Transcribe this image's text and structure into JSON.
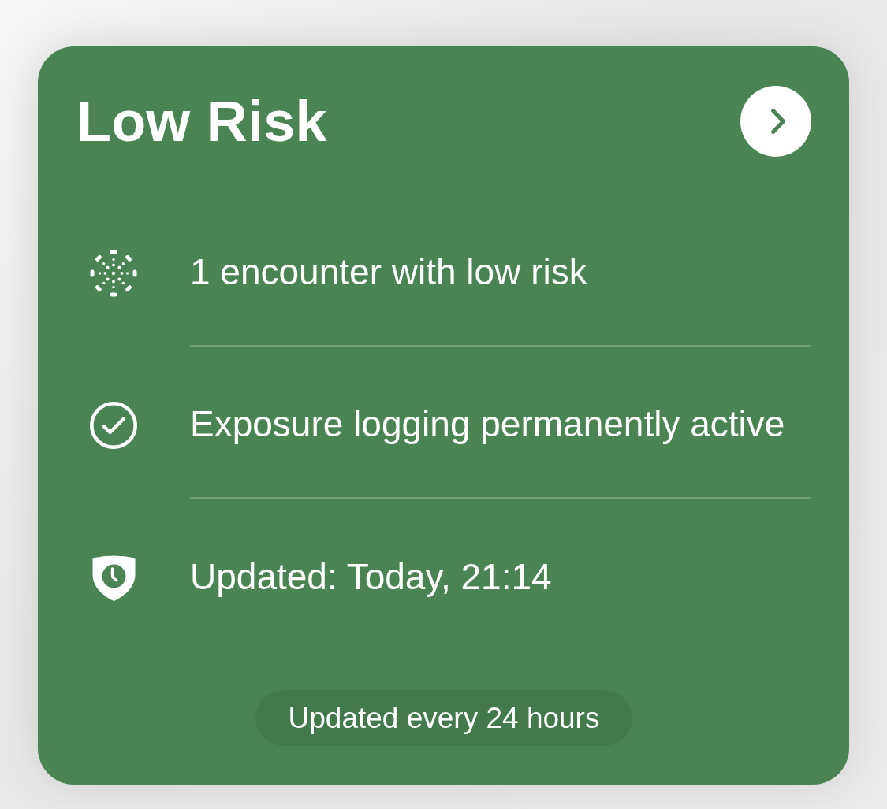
{
  "card": {
    "title": "Low Risk",
    "rows": [
      {
        "kind": "encounters",
        "text": "1 encounter with low risk"
      },
      {
        "kind": "logging",
        "text": "Exposure logging permanently active"
      },
      {
        "kind": "updated",
        "text": "Updated: Today, 21:14"
      }
    ],
    "footer_badge": "Updated every 24 hours"
  }
}
